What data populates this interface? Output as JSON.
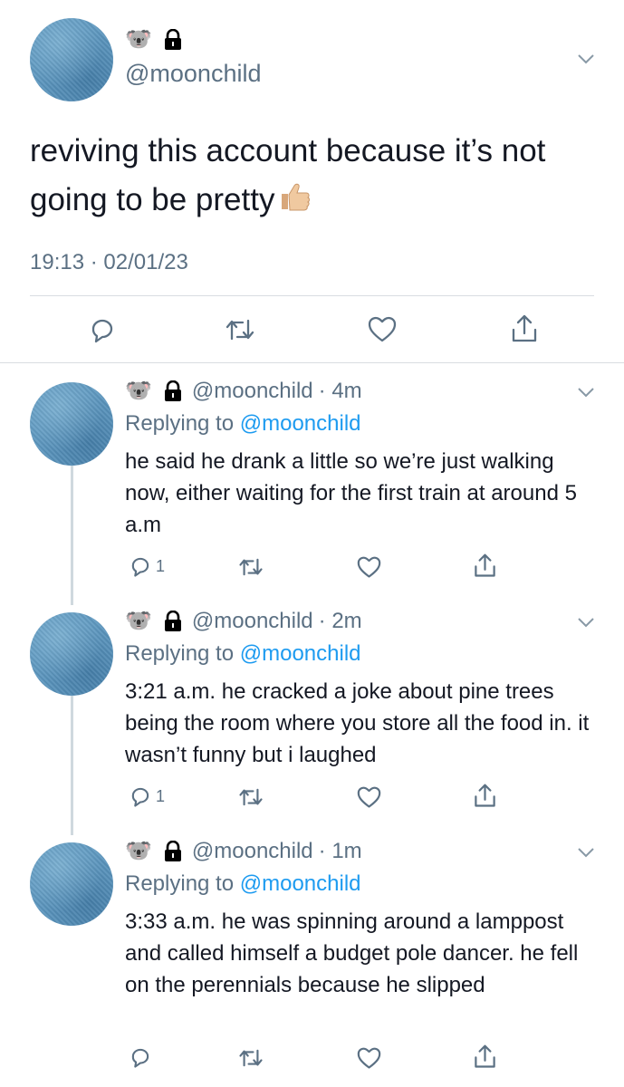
{
  "main_tweet": {
    "avatar_icon": "blue-avatar",
    "name_emoji": "🐨",
    "lock_icon": "lock-icon",
    "handle": "@moonchild",
    "text": "reviving this account because it’s not going to be pretty",
    "emoji": "👍🏼",
    "timestamp": "19:13 · 02/01/23",
    "actions": [
      "reply-icon",
      "retweet-icon",
      "like-icon",
      "share-icon"
    ]
  },
  "replies": [
    {
      "name_emoji": "🐨",
      "handle": "@moonchild",
      "time": "· 4m",
      "replying_prefix": "Replying to",
      "replying_handle": "@moonchild",
      "text": "he said he drank a little so we’re just walking now, either waiting for the first train at around 5 a.m",
      "reply_count": "1"
    },
    {
      "name_emoji": "🐨",
      "handle": "@moonchild",
      "time": "· 2m",
      "replying_prefix": "Replying to",
      "replying_handle": "@moonchild",
      "text": "3:21 a.m. he cracked a joke about pine trees being the room where you store all the food in. it wasn’t funny but i laughed",
      "reply_count": "1"
    },
    {
      "name_emoji": "🐨",
      "handle": "@moonchild",
      "time": "· 1m",
      "replying_prefix": "Replying to",
      "replying_handle": "@moonchild",
      "text": "3:33 a.m. he was spinning around a lamppost and called himself a budget pole dancer. he fell on the perennials because he slipped",
      "reply_count": ""
    }
  ],
  "colors": {
    "accent": "#1d9bf0",
    "muted": "#5b7083",
    "text": "#141823",
    "divider": "#d9dde1"
  }
}
